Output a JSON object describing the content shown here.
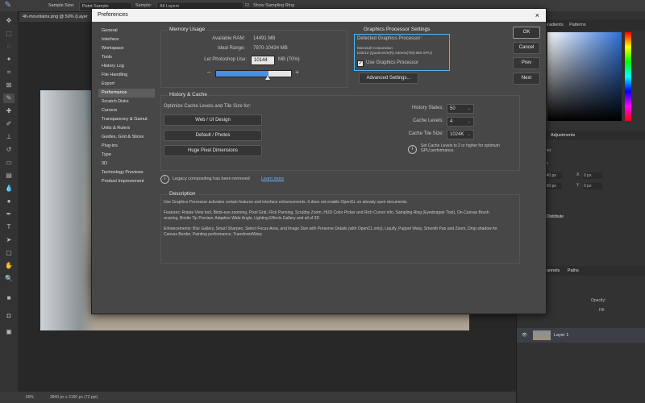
{
  "app": {
    "options_bar": {
      "sample_size_label": "Sample Size:",
      "sample_size_value": "Point Sample",
      "sample_label": "Sample:",
      "sample_value": "All Layers",
      "show_ring_label": "Show Sampling Ring"
    },
    "document_tab": "4h-mountains.png @ 50% (Layer",
    "status": {
      "zoom": "50%",
      "dimensions": "3840 px x 2160 px (72 ppi)"
    },
    "right_panel": {
      "color_tabs": [
        "watches",
        "Gradients",
        "Patterns"
      ],
      "adjust_tab": "Adjustments",
      "layer_head": "Layer",
      "transform_head": "orm",
      "distribute_head": "nd Distribute",
      "channels_tabs": [
        "hannels",
        "Paths"
      ],
      "opacity_label": "Opacity:",
      "fill_label": "Fill:",
      "layer_name": "Layer 1",
      "x_field": "3840 px",
      "y_field": "2160 px",
      "x_label": "X",
      "y_label": "Y",
      "zero_a": "0 px",
      "zero_b": "0 px"
    }
  },
  "dialog": {
    "title": "Preferences",
    "close": "×",
    "nav": [
      "General",
      "Interface",
      "Workspace",
      "Tools",
      "History Log",
      "File Handling",
      "Export",
      "Performance",
      "Scratch Disks",
      "Cursors",
      "Transparency & Gamut",
      "Units & Rulers",
      "Guides, Grid & Slices",
      "Plug-ins",
      "Type",
      "3D",
      "Technology Previews",
      "Product Improvement"
    ],
    "nav_selected": "Performance",
    "memory": {
      "title": "Memory Usage",
      "available_label": "Available RAM:",
      "available_value": "14491 MB",
      "ideal_label": "Ideal Range:",
      "ideal_value": "7970-10434 MB",
      "let_label": "Let Photoshop Use:",
      "let_value": "10144",
      "let_unit": "MB (70%)",
      "minus": "–",
      "plus": "+",
      "percent": 0.7
    },
    "gpu": {
      "title": "Graphics Processor Settings",
      "detected_label": "Detected Graphics Processor:",
      "vendor": "Microsoft Corporation",
      "device": "D3D12 (Qualcomm(R) Adreno(TM) 680 GPU)",
      "use_gpu_label": "Use Graphics Processor",
      "use_gpu_checked": true,
      "advanced_button": "Advanced Settings..."
    },
    "history": {
      "title": "History & Cache",
      "optimize_label": "Optimize Cache Levels and Tile Size for:",
      "buttons": [
        "Web / UI Design",
        "Default / Photos",
        "Huge Pixel Dimensions"
      ],
      "history_states_label": "History States:",
      "history_states_value": "50",
      "cache_levels_label": "Cache Levels:",
      "cache_levels_value": "4",
      "tile_size_label": "Cache Tile Size:",
      "tile_size_value": "1024K",
      "hint": "Set Cache Levels to 2 or higher for optimum GPU performance."
    },
    "legacy": {
      "text": "Legacy compositing has been removed",
      "link": "Learn more"
    },
    "description": {
      "title": "Description",
      "p1": "Use Graphics Processor activates certain features and interface enhancements. It does not enable OpenGL on already open documents.",
      "p2": "Features: Rotate View tool, Birds-eye zooming, Pixel Grid, Flick Panning, Scrubby Zoom, HUD Color Picker and Rich Cursor info, Sampling Ring (Eyedropper Tool), On-Canvas Brush resizing, Bristle Tip Preview, Adaptive Wide Angle, Lighting Effects Gallery and all of 3D",
      "p3": "Enhancements: Blur Gallery, Smart Sharpen, Select Focus Area, and Image Size with Preserve Details (with OpenCL only), Liquify, Puppet Warp, Smooth Pan and Zoom, Drop shadow for Canvas Border, Painting performance, Transform/Warp"
    },
    "side_buttons": [
      "OK",
      "Cancel",
      "Prev",
      "Next"
    ]
  }
}
